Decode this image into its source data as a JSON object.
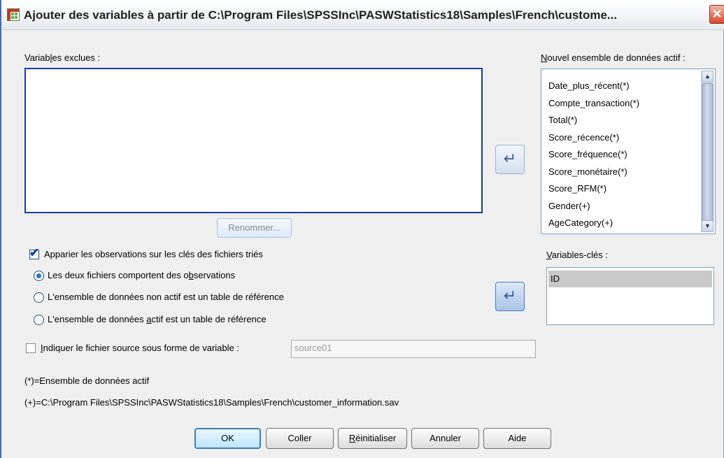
{
  "window": {
    "title": "Ajouter des variables à partir de C:\\Program Files\\SPSSInc\\PASWStatistics18\\Samples\\French\\custome...",
    "close_symbol": "✕",
    "icon": "spss-data-icon"
  },
  "excluded": {
    "label_pre": "Variab",
    "label_u": "l",
    "label_post": "es exclues :",
    "items": []
  },
  "rename_button": "Renommer...",
  "new_active": {
    "label_u": "N",
    "label_post": "ouvel ensemble de données actif :",
    "items": [
      "Date_plus_récent(*)",
      "Compte_transaction(*)",
      "Total(*)",
      "Score_récence(*)",
      "Score_fréquence(*)",
      "Score_monétaire(*)",
      "Score_RFM(*)",
      "Gender(+)",
      "AgeCategory(+)"
    ]
  },
  "key_vars": {
    "label_u": "V",
    "label_post": "ariables-clés :",
    "items": [
      "ID"
    ]
  },
  "match": {
    "checked": true,
    "label": "Apparier les observations sur les clés des fichiers triés",
    "options": [
      {
        "pre": "Les deux fichiers comportent des o",
        "u": "b",
        "post": "servations",
        "selected": true
      },
      {
        "pre": "L'ensemble de données non actif est un table de référence",
        "u": "",
        "post": "",
        "selected": false
      },
      {
        "pre": "L'ensemble de données ",
        "u": "a",
        "post": "ctif est un table de référence",
        "selected": false
      }
    ]
  },
  "source_var": {
    "checked": false,
    "label_u": "I",
    "label_post": "ndiquer le fichier source sous forme de variable :",
    "value": "source01"
  },
  "legend": {
    "active": "(*)=Ensemble de données actif",
    "inactive": "(+)=C:\\Program Files\\SPSSInc\\PASWStatistics18\\Samples\\French\\customer_information.sav"
  },
  "buttons": {
    "ok": "OK",
    "paste": "Coller",
    "reset_u": "R",
    "reset_post": "éinitialiser",
    "cancel": "Annuler",
    "help": "Aide"
  },
  "icons": {
    "move_arrow": "↵",
    "scroll_up": "▲",
    "scroll_down": "▼"
  }
}
